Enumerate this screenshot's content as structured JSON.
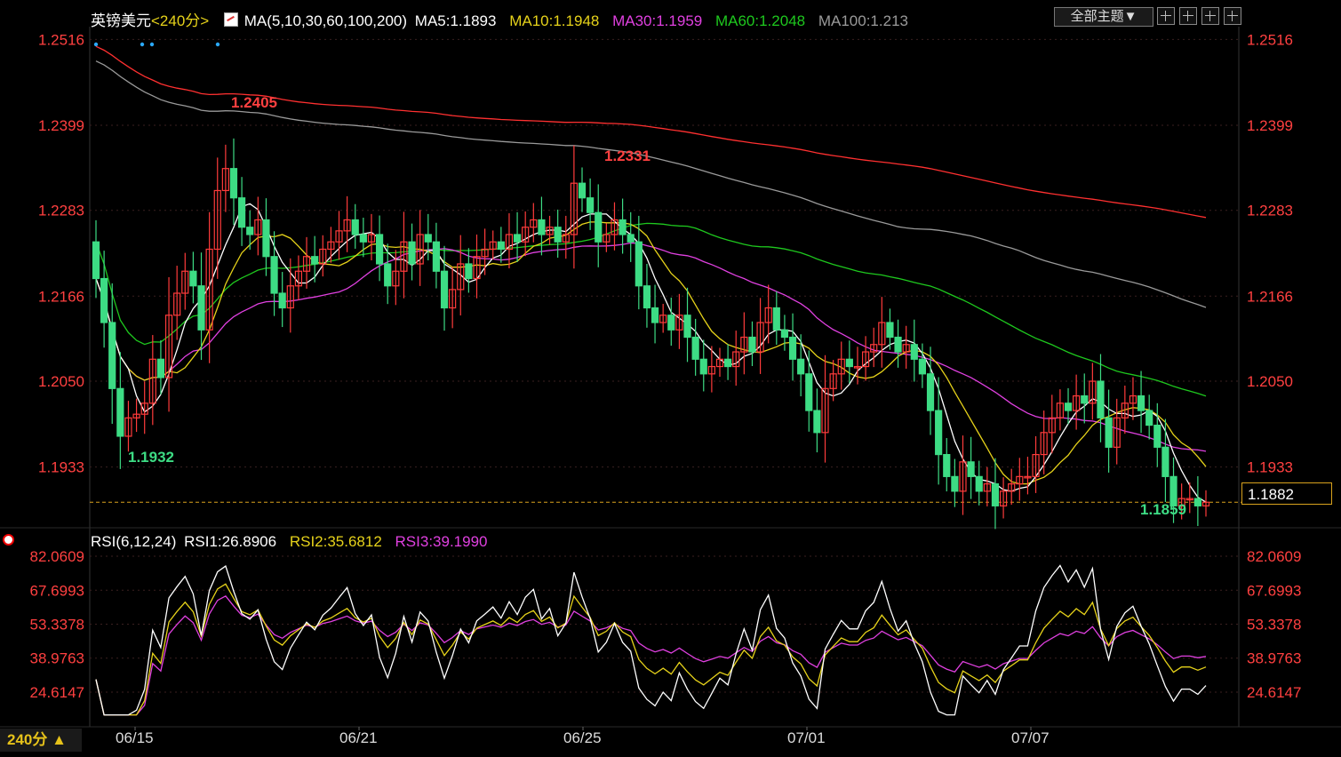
{
  "header": {
    "symbol": "英镑美元",
    "period_tag": "<240分>",
    "ma_title": "MA(5,10,30,60,100,200)",
    "ma5": "MA5:1.1893",
    "ma10": "MA10:1.1948",
    "ma30": "MA30:1.1959",
    "ma60": "MA60:1.2048",
    "ma100": "MA100:1.213",
    "theme_button": "全部主题▼"
  },
  "rsi_header": {
    "title": "RSI(6,12,24)",
    "rsi1": "RSI1:26.8906",
    "rsi2": "RSI2:35.6812",
    "rsi3": "RSI3:39.1990"
  },
  "period_button": "240分 ▲",
  "current_price": "1.1882",
  "colors": {
    "up": "#ff3b3b",
    "down": "#3ddc84",
    "ma5": "#ffffff",
    "ma10": "#e6d21a",
    "ma30": "#e040e0",
    "ma60": "#1ec81e",
    "ma100": "#9a9a9a",
    "ma200": "#ff3030",
    "axis_price": "#ff4040",
    "rsi1": "#ffffff",
    "rsi2": "#e6d21a",
    "rsi3": "#e040e0",
    "last_price_line": "#d9a21d"
  },
  "chart_data": [
    {
      "type": "candlestick",
      "y_ticks": [
        "1.2516",
        "1.2399",
        "1.2283",
        "1.2166",
        "1.2050",
        "1.1933"
      ],
      "ylim": [
        1.1855,
        1.2525
      ],
      "x_tick_labels": [
        "06/15",
        "06/21",
        "06/25",
        "07/01",
        "07/07"
      ],
      "high_annotation": "1.2405",
      "low_annotation": "1.1932",
      "mid_high_annotation": "1.2331",
      "recent_low_annotation": "1.1859",
      "close": [
        1.219,
        1.213,
        1.204,
        1.1975,
        1.2,
        1.2005,
        1.202,
        1.208,
        1.2055,
        1.214,
        1.217,
        1.22,
        1.218,
        1.212,
        1.223,
        1.231,
        1.234,
        1.23,
        1.226,
        1.225,
        1.227,
        1.222,
        1.217,
        1.215,
        1.218,
        1.22,
        1.222,
        1.221,
        1.223,
        1.224,
        1.2255,
        1.227,
        1.225,
        1.224,
        1.225,
        1.221,
        1.218,
        1.22,
        1.224,
        1.221,
        1.225,
        1.224,
        1.22,
        1.215,
        1.2175,
        1.221,
        1.219,
        1.222,
        1.223,
        1.224,
        1.223,
        1.225,
        1.224,
        1.226,
        1.227,
        1.225,
        1.226,
        1.224,
        1.225,
        1.232,
        1.23,
        1.228,
        1.224,
        1.225,
        1.227,
        1.225,
        1.224,
        1.218,
        1.215,
        1.213,
        1.214,
        1.212,
        1.214,
        1.211,
        1.208,
        1.206,
        1.207,
        1.208,
        1.207,
        1.209,
        1.211,
        1.209,
        1.213,
        1.215,
        1.212,
        1.211,
        1.208,
        1.206,
        1.201,
        1.198,
        1.204,
        1.206,
        1.208,
        1.207,
        1.207,
        1.209,
        1.21,
        1.213,
        1.211,
        1.209,
        1.21,
        1.208,
        1.206,
        1.201,
        1.195,
        1.192,
        1.19,
        1.194,
        1.192,
        1.19,
        1.191,
        1.188,
        1.19,
        1.191,
        1.192,
        1.192,
        1.195,
        1.198,
        1.2,
        1.202,
        1.201,
        1.203,
        1.202,
        1.205,
        1.2,
        1.196,
        1.2,
        1.202,
        1.203,
        1.201,
        1.199,
        1.196,
        1.192,
        1.188,
        1.189,
        1.189,
        1.188,
        1.1885
      ]
    },
    {
      "type": "line",
      "y_ticks": [
        "82.0609",
        "67.6993",
        "53.3378",
        "38.9763",
        "24.6147"
      ],
      "ylim": [
        15,
        87
      ]
    }
  ]
}
